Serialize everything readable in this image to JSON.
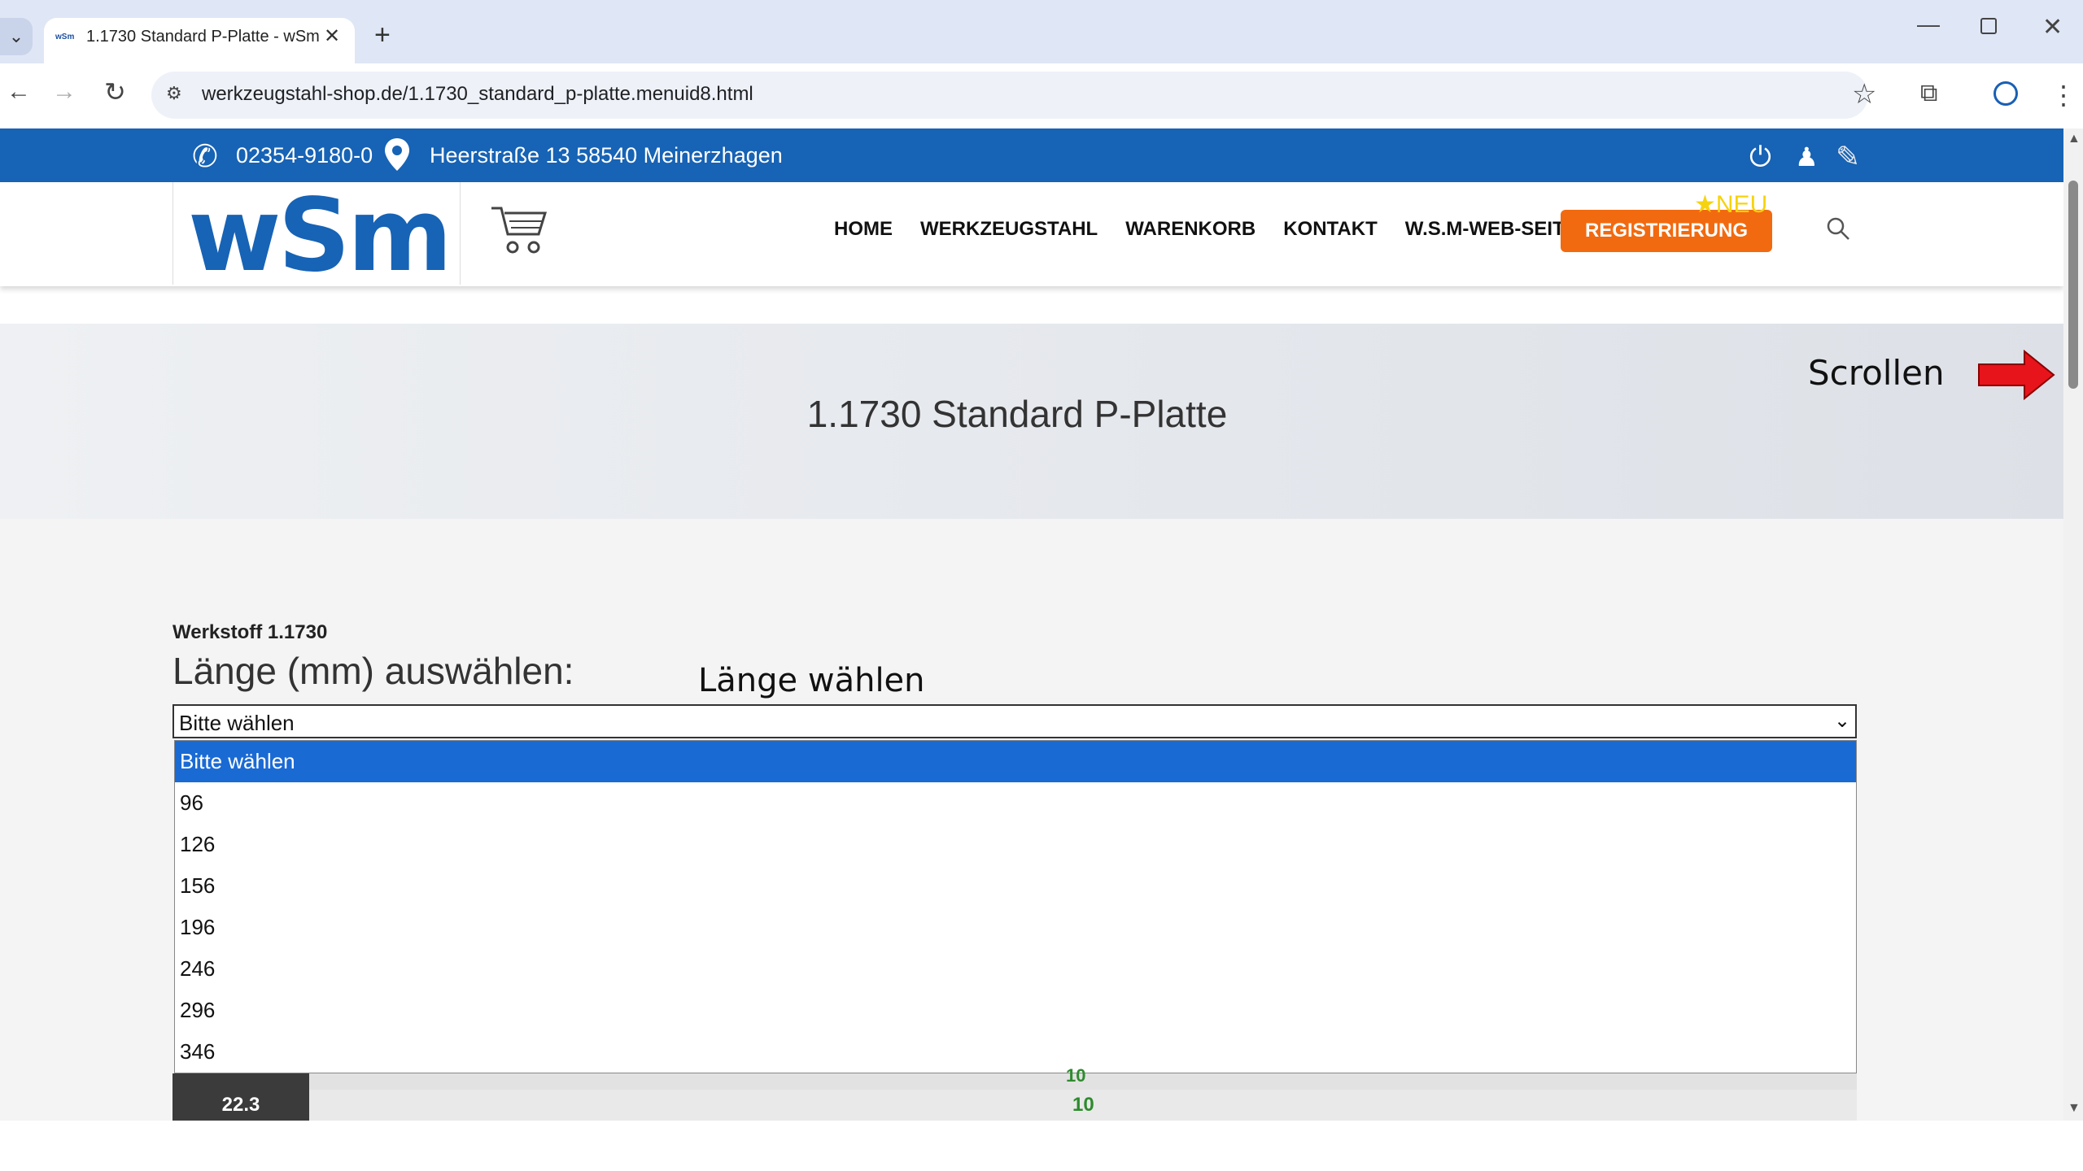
{
  "browser": {
    "tab_title": "1.1730 Standard P-Platte - wSm",
    "tab_favicon": "wSm",
    "url": "werkzeugstahl-shop.de/1.1730_standard_p-platte.menuid8.html"
  },
  "topbar": {
    "phone": "02354-9180-0",
    "address": "Heerstraße 13 58540 Meinerzhagen"
  },
  "header": {
    "logo": "wSm",
    "nav": [
      "HOME",
      "WERKZEUGSTAHL",
      "WARENKORB",
      "KONTAKT",
      "W.S.M-WEB-SEITE"
    ],
    "register_label": "REGISTRIERUNG",
    "neu_badge": "★NEU"
  },
  "hero": {
    "title": "1.1730 Standard P-Platte"
  },
  "annotations": {
    "scroll": "Scrollen",
    "choose_length": "Länge wählen"
  },
  "form": {
    "material": "Werkstoff 1.1730",
    "heading": "Länge (mm) auswählen:",
    "select_value": "Bitte wählen",
    "options": [
      "Bitte wählen",
      "96",
      "126",
      "156",
      "196",
      "246",
      "296",
      "346"
    ]
  },
  "table": {
    "partial_row_value": "10",
    "row_label": "22.3",
    "row_value": "10"
  },
  "colors": {
    "brand_blue": "#1763b5",
    "register_orange": "#f26a0f",
    "selected_option": "#1a6ad4",
    "stock_green": "#2e8b2e"
  }
}
